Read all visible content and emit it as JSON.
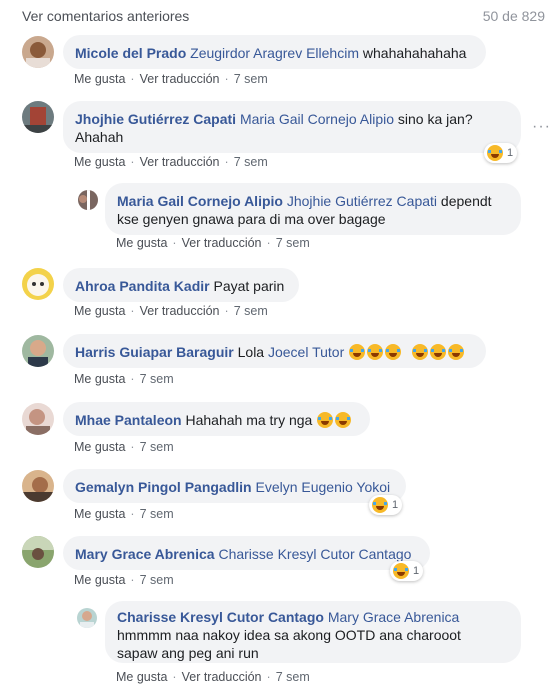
{
  "header": {
    "prev_comments": "Ver comentarios anteriores",
    "count": "50 de 829"
  },
  "labels": {
    "like": "Me gusta",
    "translate": "Ver traducción",
    "sep": "·"
  },
  "icons": {
    "reaction": "laughing-emoji-icon",
    "options": "more-options-icon"
  },
  "comments": [
    {
      "author": "Micole del Prado",
      "mention": "Zeugirdor Aragrev Ellehcim",
      "text": "whahahahahaha",
      "time": "7 sem"
    },
    {
      "author": "Jhojhie Gutiérrez Capati",
      "mention": "Maria Gail Cornejo Alipio",
      "text_line1": "sino ka jan?",
      "text_line2": "Ahahah",
      "time": "7 sem",
      "reaction_count": "1"
    },
    {
      "author": "Maria Gail Cornejo Alipio",
      "mention": "Jhojhie Gutiérrez Capati",
      "text_line1": "dependt",
      "text_line2": "kse genyen gnawa para di ma over bagage",
      "time": "7 sem"
    },
    {
      "author": "Ahroa Pandita Kadir",
      "text": "Payat parin",
      "time": "7 sem"
    },
    {
      "author": "Harris Guiapar Baraguir",
      "pre": "Lola",
      "mention": "Joecel Tutor",
      "time": "7 sem"
    },
    {
      "author": "Mhae Pantaleon",
      "text": "Hahahah ma try nga",
      "time": "7 sem"
    },
    {
      "author": "Gemalyn Pingol Pangadlin",
      "mention": "Evelyn Eugenio Yokoi",
      "time": "7 sem",
      "reaction_count": "1"
    },
    {
      "author": "Mary Grace Abrenica",
      "mention": "Charisse Kresyl Cutor Cantago",
      "time": "7 sem",
      "reaction_count": "1"
    },
    {
      "author": "Charisse Kresyl Cutor Cantago",
      "mention": "Mary Grace Abrenica",
      "text_line1": "hmmmm naa nakoy idea sa akong OOTD ana charooot",
      "text_line2": "sapaw ang peg ani run",
      "time": "7 sem"
    }
  ]
}
